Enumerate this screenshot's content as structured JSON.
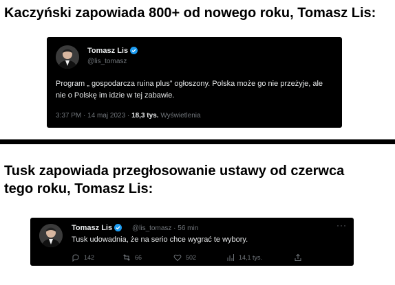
{
  "heading1": "Kaczyński zapowiada 800+ od nowego roku, Tomasz Lis:",
  "heading2": "Tusk zapowiada przegłosowanie ustawy od czerwca tego roku, Tomasz Lis:",
  "tweet1": {
    "name": "Tomasz Lis",
    "handle": "@lis_tomasz",
    "text": "Program „ gospodarcza ruina plus” ogłoszony. Polska może go nie przeżyje, ale nie o Polskę im idzie w tej zabawie.",
    "time": "3:37 PM · 14 maj 2023 ·",
    "views_count": "18,3 tys.",
    "views_label": "Wyświetlenia",
    "verified_color": "#1d9bf0"
  },
  "tweet2": {
    "name": "Tomasz Lis",
    "handle_time": "@lis_tomasz · 56 min",
    "more": "···",
    "text": "Tusk udowadnia, że na serio chce wygrać te wybory.",
    "replies": "142",
    "retweets": "66",
    "likes": "502",
    "views": "14,1 tys.",
    "icons": [
      "reply-icon",
      "retweet-icon",
      "like-icon",
      "views-icon",
      "share-icon"
    ]
  }
}
